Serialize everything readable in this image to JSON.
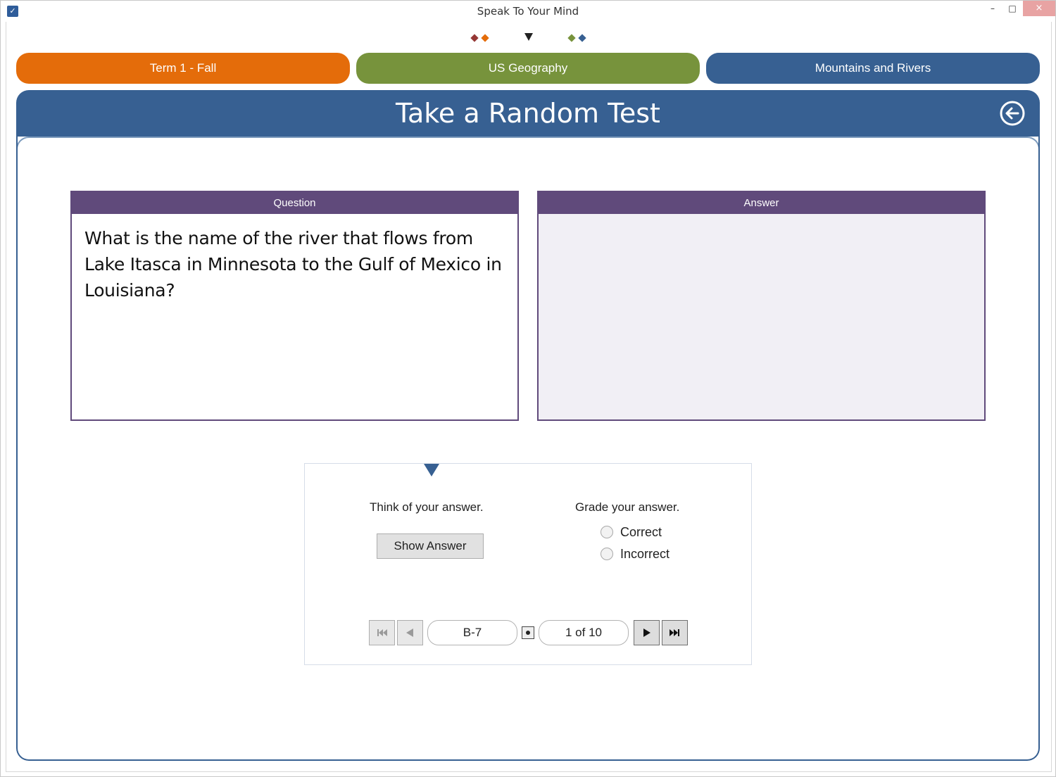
{
  "window": {
    "title": "Speak To Your Mind",
    "minimize_glyph": "–",
    "maximize_glyph": "□",
    "close_glyph": "×"
  },
  "breadcrumb": {
    "left_colors": [
      "#953735",
      "#e46c0a"
    ],
    "right_colors": [
      "#77933c",
      "#376092"
    ]
  },
  "tabs": {
    "term": "Term 1 - Fall",
    "subject": "US Geography",
    "topic": "Mountains and Rivers"
  },
  "header": {
    "title": "Take a Random Test",
    "back_icon": "back-arrow-circle-icon"
  },
  "question_panel": {
    "heading": "Question",
    "text": "What is the name of the river that flows from Lake Itasca in Minnesota to the Gulf of Mexico in Louisiana?"
  },
  "answer_panel": {
    "heading": "Answer",
    "text": ""
  },
  "controls": {
    "think_label": "Think of your answer.",
    "show_answer_label": "Show Answer",
    "grade_label": "Grade your answer.",
    "options": [
      "Correct",
      "Incorrect"
    ]
  },
  "pager": {
    "card_id": "B-7",
    "position": "1 of 10"
  },
  "colors": {
    "term": "#e46c0a",
    "subject": "#77933c",
    "topic": "#376092",
    "panel_header": "#604a7b",
    "answer_bg": "#f1eff5"
  }
}
